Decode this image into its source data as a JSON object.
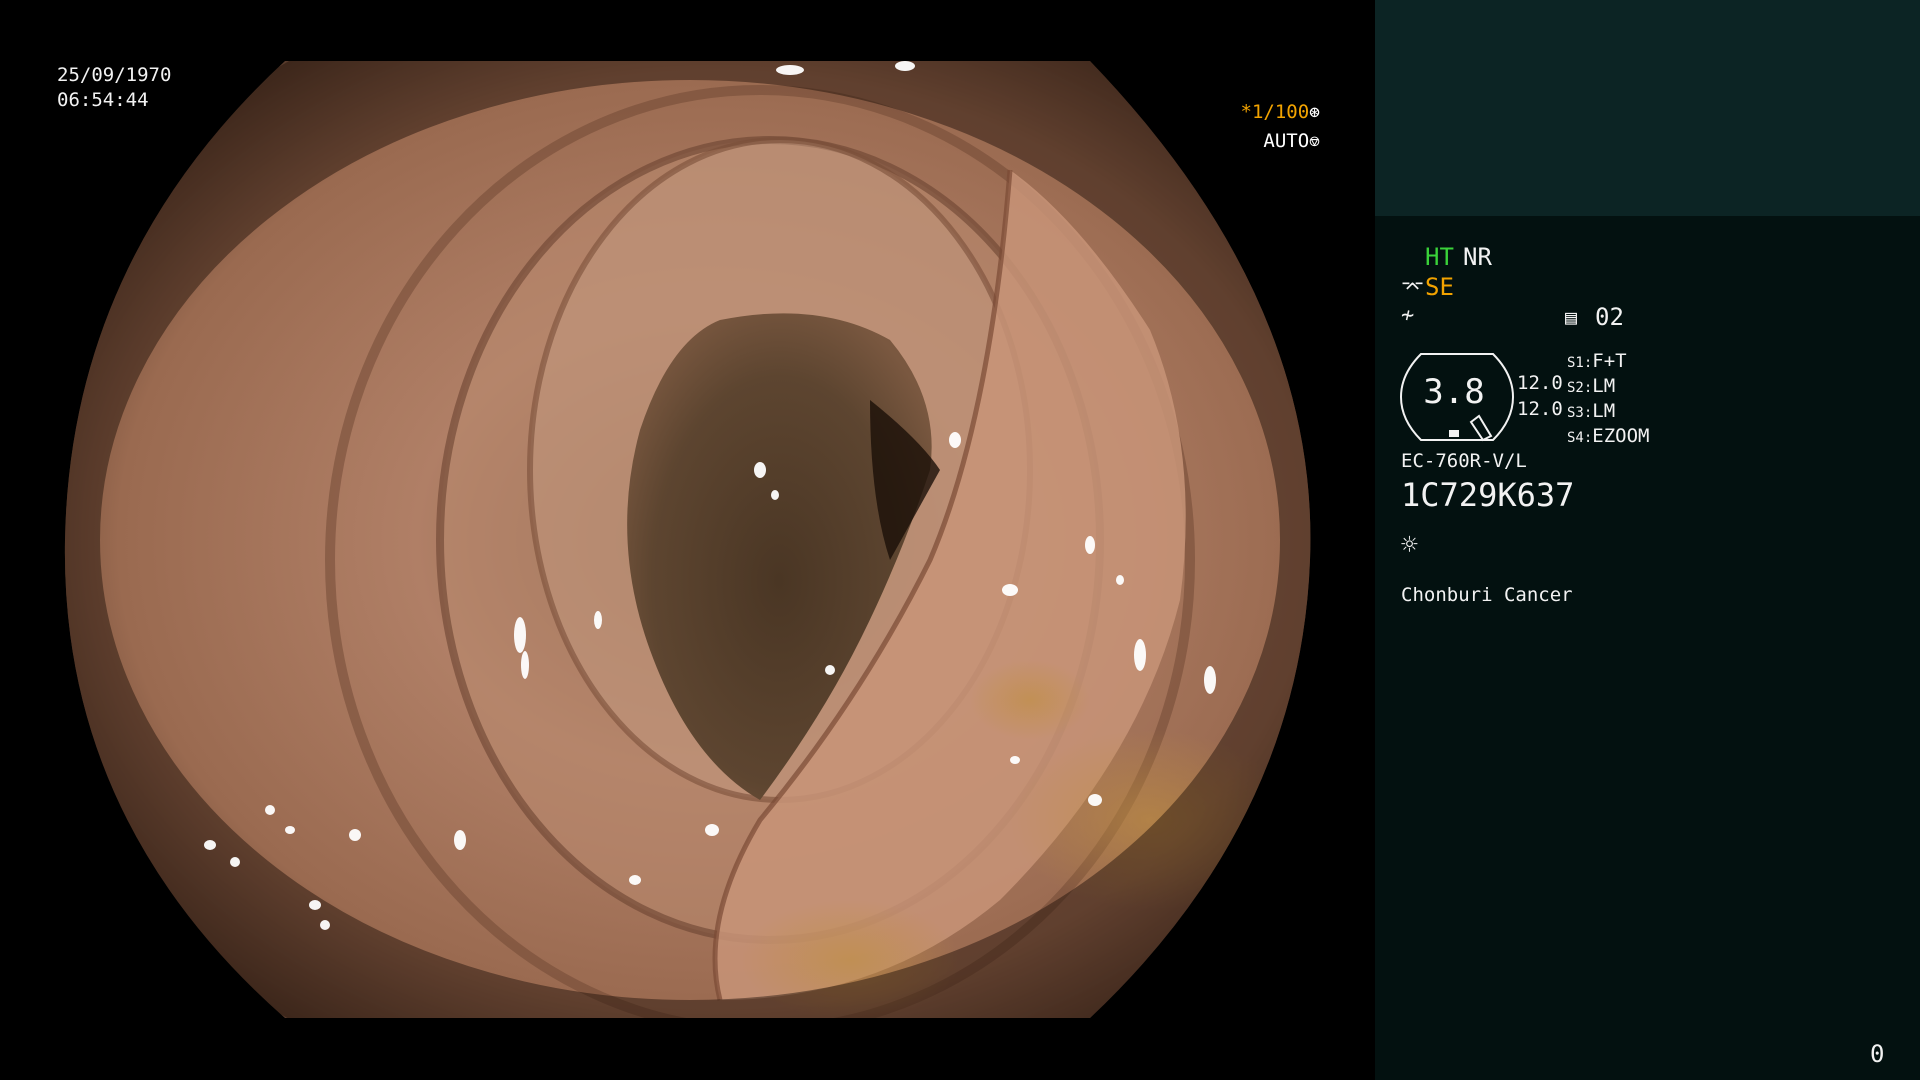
{
  "overlay": {
    "date": "25/09/1970",
    "time": "06:54:44",
    "shutter_value": "*1/100",
    "iris_mode": "AUTO"
  },
  "panel": {
    "ht_label": "HT",
    "nr_label": "NR",
    "se_label": "SE",
    "memory_num": "02",
    "gauge_value": "3.8",
    "gauge_left_top": "12.0",
    "gauge_left_bottom": "12.0",
    "switches": [
      {
        "key": "S1:",
        "value": "F+T"
      },
      {
        "key": "S2:",
        "value": "LM"
      },
      {
        "key": "S3:",
        "value": "LM"
      },
      {
        "key": "S4:",
        "value": "EZOOM"
      }
    ],
    "scope_model": "EC-760R-V/L",
    "serial": "1C729K637",
    "institution": "Chonburi Cancer",
    "counter": "0"
  },
  "colors": {
    "panel_bg": "#031110",
    "panel_top_bg": "#0c2424",
    "accent_green": "#3ad23a",
    "accent_orange": "#f2a300"
  }
}
